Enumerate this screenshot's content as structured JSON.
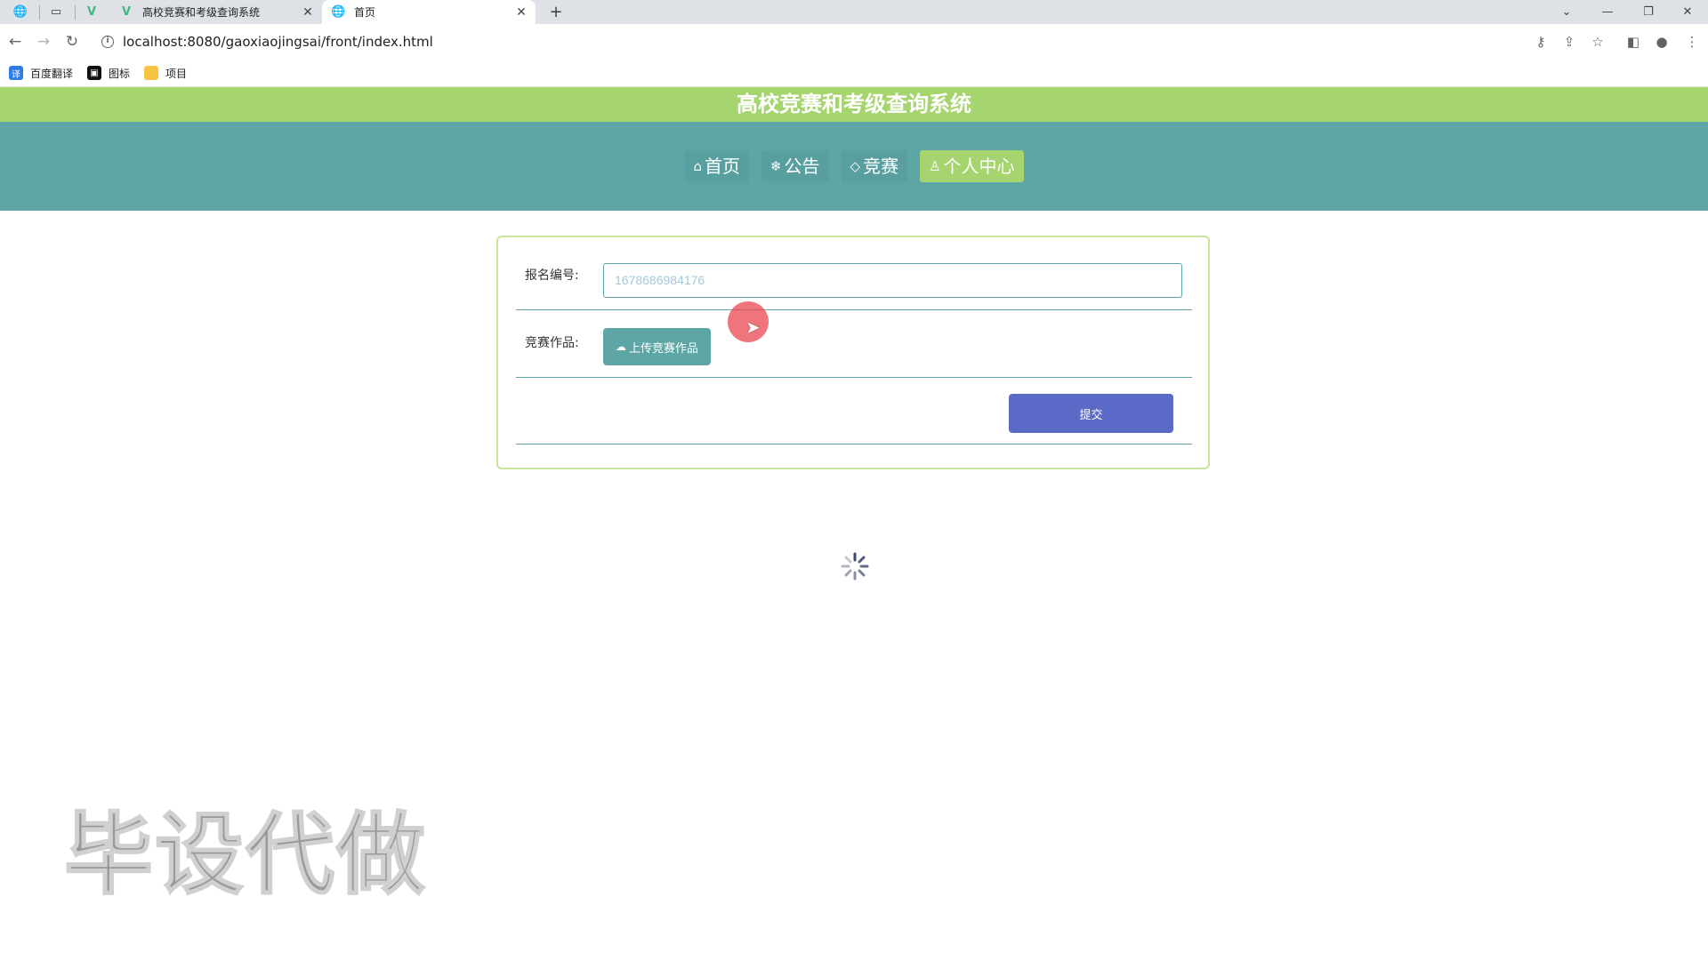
{
  "browser": {
    "tabs": [
      {
        "title": "高校竞赛和考级查询系统",
        "active": false
      },
      {
        "title": "首页",
        "active": true
      }
    ],
    "url": "localhost:8080/gaoxiaojingsai/front/index.html",
    "bookmarks": [
      "百度翻译",
      "图标",
      "项目"
    ]
  },
  "site": {
    "title": "高校竞赛和考级查询系统",
    "nav": [
      {
        "label": "首页",
        "icon": "home-icon",
        "active": false
      },
      {
        "label": "公告",
        "icon": "snowflake-icon",
        "active": false
      },
      {
        "label": "竞赛",
        "icon": "tag-icon",
        "active": false
      },
      {
        "label": "个人中心",
        "icon": "user-icon",
        "active": true
      }
    ],
    "colors": {
      "title_bar": "#a6d56f",
      "nav_bar": "#5ea6a6",
      "submit": "#5b6ac6"
    }
  },
  "form": {
    "reg_no_label": "报名编号:",
    "reg_no_value": "1678686984176",
    "work_label": "竞赛作品:",
    "upload_label": "上传竞赛作品",
    "submit_label": "提交"
  },
  "watermark": "毕设代做"
}
